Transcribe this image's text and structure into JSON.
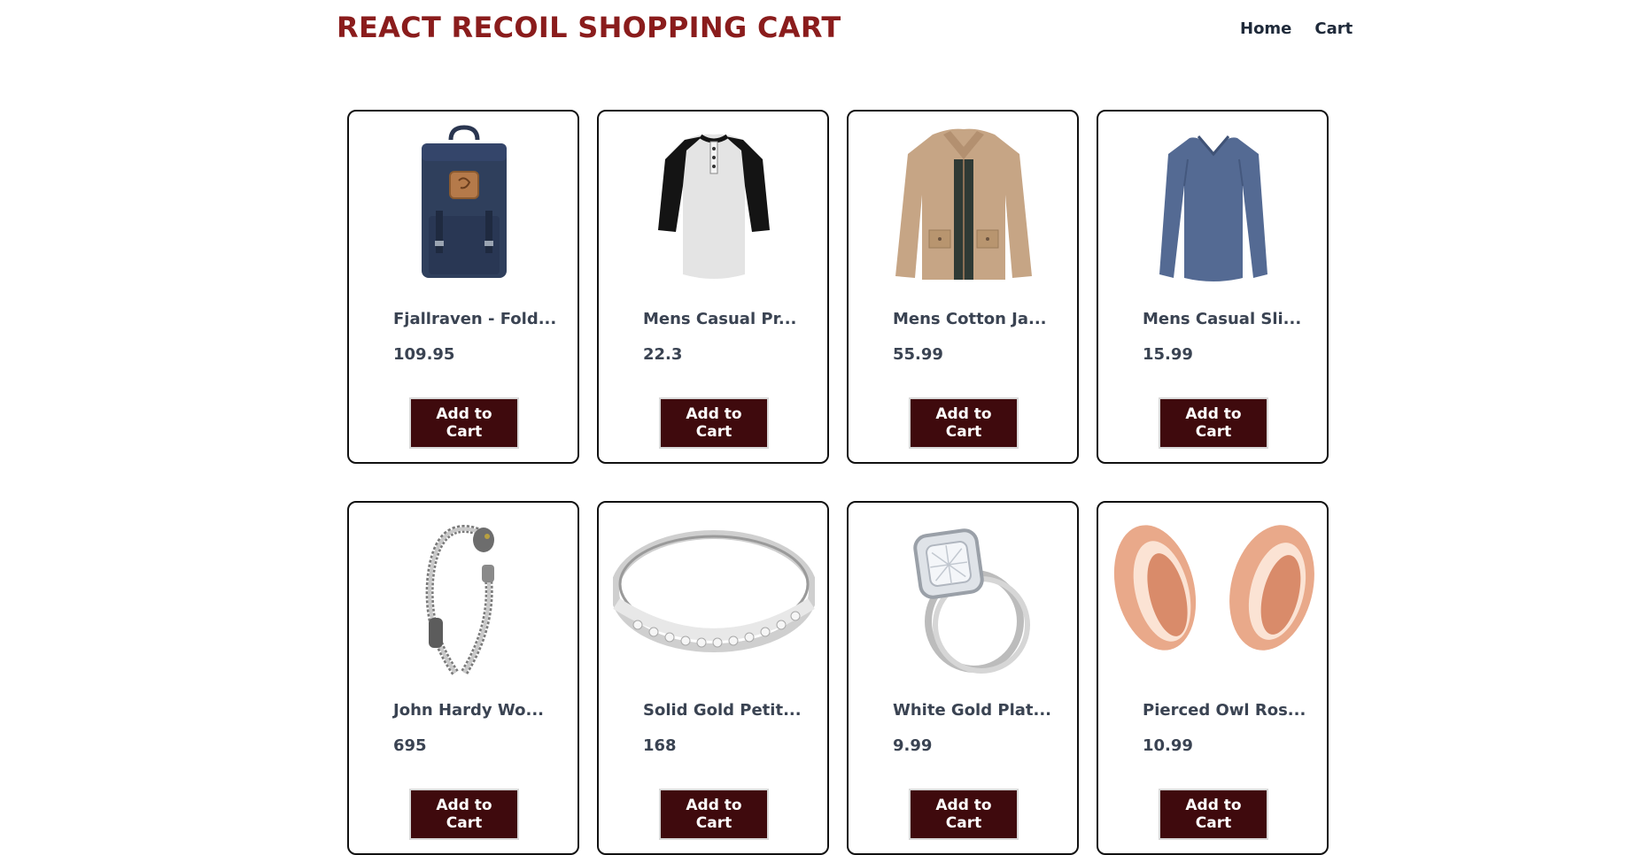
{
  "header": {
    "title": "REACT RECOIL SHOPPING CART",
    "nav": [
      {
        "label": "Home"
      },
      {
        "label": "Cart"
      }
    ]
  },
  "products": [
    {
      "title": "Fjallraven - Fold...",
      "price": "109.95",
      "button": "Add to Cart",
      "icon": "backpack-image"
    },
    {
      "title": "Mens Casual Pr...",
      "price": "22.3",
      "button": "Add to Cart",
      "icon": "raglan-tshirt-image"
    },
    {
      "title": "Mens Cotton Ja...",
      "price": "55.99",
      "button": "Add to Cart",
      "icon": "cotton-jacket-image"
    },
    {
      "title": "Mens Casual Sli...",
      "price": "15.99",
      "button": "Add to Cart",
      "icon": "longsleeve-shirt-image"
    },
    {
      "title": "John Hardy Wo...",
      "price": "695",
      "button": "Add to Cart",
      "icon": "chain-bracelet-image"
    },
    {
      "title": "Solid Gold Petit...",
      "price": "168",
      "button": "Add to Cart",
      "icon": "gold-ring-image"
    },
    {
      "title": "White Gold Plat...",
      "price": "9.99",
      "button": "Add to Cart",
      "icon": "diamond-ring-image"
    },
    {
      "title": "Pierced Owl Ros...",
      "price": "10.99",
      "button": "Add to Cart",
      "icon": "rose-gold-plugs-image"
    }
  ],
  "colors": {
    "brand": "#8a1c1c",
    "button_bg": "#3f0a0d",
    "text": "#3a4352"
  }
}
